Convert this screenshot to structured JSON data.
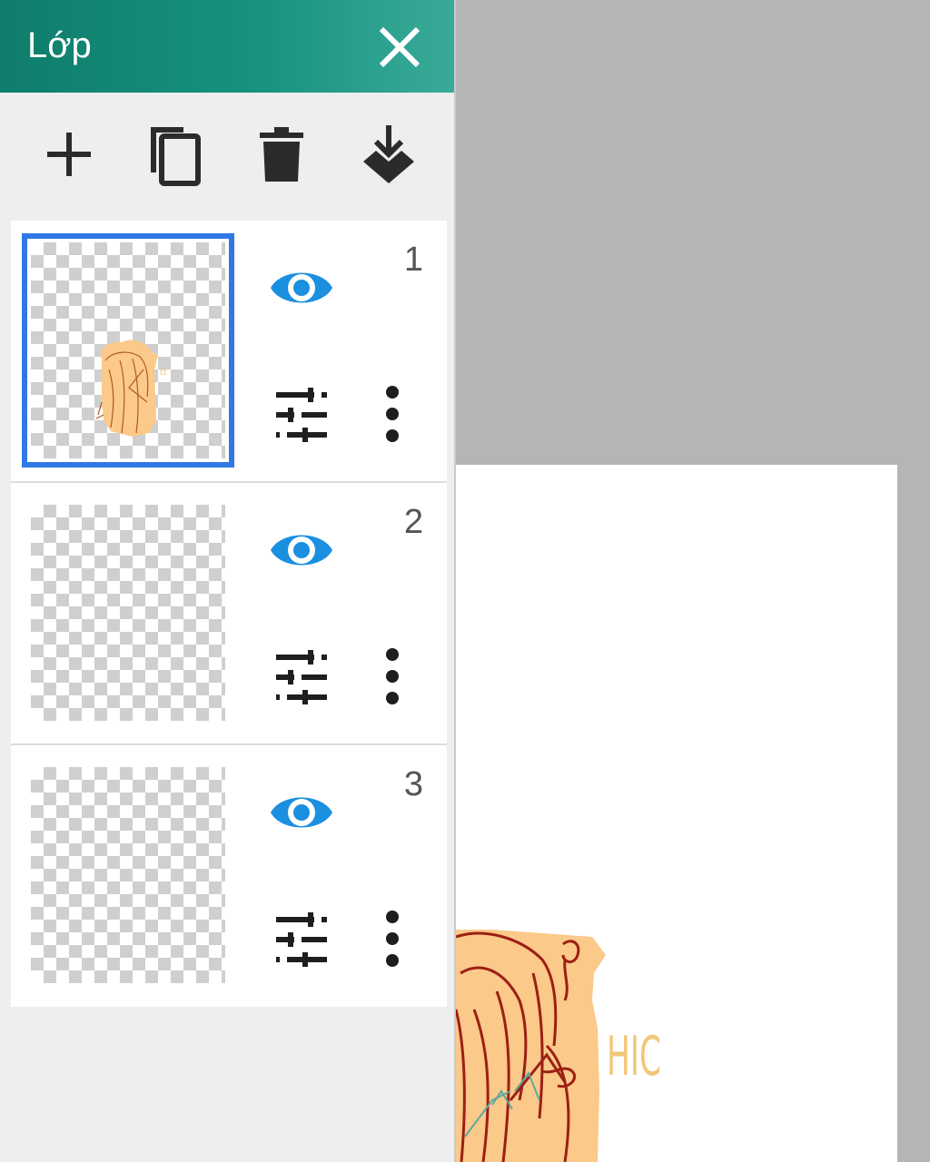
{
  "panel": {
    "title": "Lớp",
    "close_icon": "close-icon"
  },
  "toolbar": {
    "buttons": [
      {
        "name": "add-layer",
        "icon": "plus-icon"
      },
      {
        "name": "duplicate-layer",
        "icon": "copy-icon"
      },
      {
        "name": "delete-layer",
        "icon": "trash-icon"
      },
      {
        "name": "merge-down",
        "icon": "merge-down-icon"
      }
    ]
  },
  "layers": [
    {
      "number": "1",
      "selected": true,
      "visible": true
    },
    {
      "number": "2",
      "selected": false,
      "visible": true
    },
    {
      "number": "3",
      "selected": false,
      "visible": true
    }
  ],
  "canvas": {
    "partial_text": "HIC",
    "colors": {
      "skin": "#fbc98a",
      "line": "#9c1f14",
      "text": "#f1c778",
      "accent": "#2f78e6",
      "eye": "#1b8fe0"
    }
  }
}
